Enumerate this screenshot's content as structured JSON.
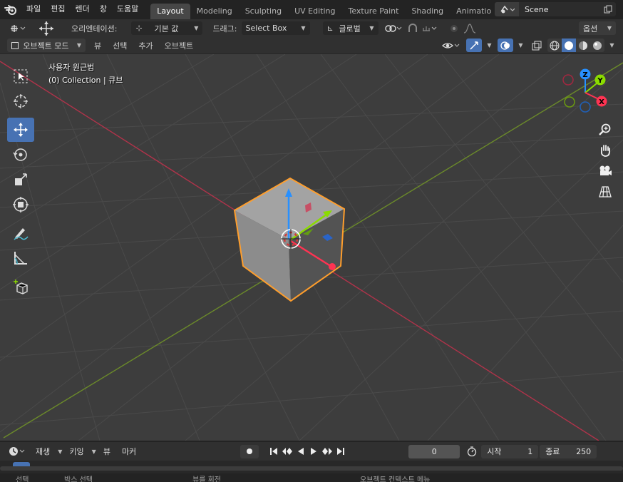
{
  "topbar": {
    "logo_icon": "blender-logo-icon",
    "menu": [
      "파일",
      "편집",
      "렌더",
      "창",
      "도움말"
    ],
    "workspace_tabs": [
      "Layout",
      "Modeling",
      "Sculpting",
      "UV Editing",
      "Texture Paint",
      "Shading",
      "Animatio"
    ],
    "active_tab": "Layout",
    "scene": "Scene"
  },
  "header_tools": {
    "orientation_label": "오리엔테이션:",
    "orientation_value": "기본 값",
    "drag_label": "드래그:",
    "drag_value": "Select Box",
    "transform_orientation": "글로벌",
    "options_label": "옵션"
  },
  "viewport_header": {
    "mode": "오브젝트 모드",
    "menus": [
      "뷰",
      "선택",
      "추가",
      "오브젝트"
    ]
  },
  "viewport": {
    "view_name": "사용자 원근법",
    "collection_info": "(0) Collection | 큐브",
    "tools": [
      "select-box-icon",
      "cursor-icon",
      "move-icon",
      "rotate-icon",
      "scale-icon",
      "transform-icon",
      "annotate-icon",
      "measure-icon",
      "add-cube-icon"
    ],
    "active_tool": "move-icon",
    "gizmo_axes": {
      "x": "X",
      "y": "Y",
      "z": "Z"
    },
    "nav_buttons": [
      "zoom-icon",
      "hand-pan-icon",
      "camera-icon",
      "grid-ortho-icon"
    ]
  },
  "colors": {
    "accent": "#4772b3",
    "x_axis": "#ff3352",
    "y_axis": "#8bdc00",
    "z_axis": "#2890ff",
    "selection": "#ff9e2c"
  },
  "timeline": {
    "menus": [
      "재생",
      "키잉",
      "뷰",
      "마커"
    ],
    "current_frame": "0",
    "start_label": "시작",
    "start_value": "1",
    "end_label": "종료",
    "end_value": "250"
  },
  "statusbar": {
    "items": [
      "선택",
      "박스 선택",
      "뷰를 회전",
      "오브젝트 컨텍스트 메뉴"
    ]
  }
}
